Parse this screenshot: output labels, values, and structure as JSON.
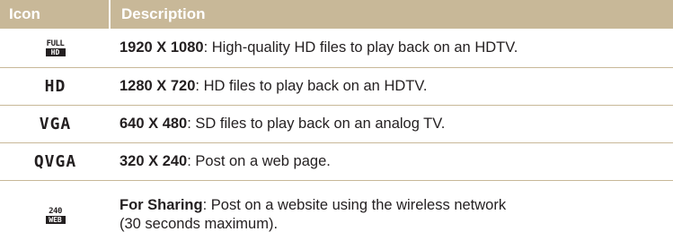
{
  "header": {
    "icon_label": "Icon",
    "desc_label": "Description"
  },
  "rows": [
    {
      "icon_name": "full-hd-icon",
      "icon_top": "FULL",
      "icon_bottom": "HD",
      "bold": "1920 X 1080",
      "text": ": High-quality HD files to play back on an HDTV."
    },
    {
      "icon_name": "hd-icon",
      "icon_text": "HD",
      "bold": "1280 X 720",
      "text": ": HD files to play back on an HDTV."
    },
    {
      "icon_name": "vga-icon",
      "icon_text": "VGA",
      "bold": "640 X 480",
      "text": ": SD files to play back on an analog TV."
    },
    {
      "icon_name": "qvga-icon",
      "icon_text": "QVGA",
      "bold": "320 X 240",
      "text": ": Post on a web page."
    },
    {
      "icon_name": "web-sharing-icon",
      "icon_top": "240",
      "icon_bottom": "WEB",
      "bold": "For Sharing",
      "text": ": Post on a website using the wireless network",
      "text_line2": "(30 seconds maximum)."
    }
  ]
}
